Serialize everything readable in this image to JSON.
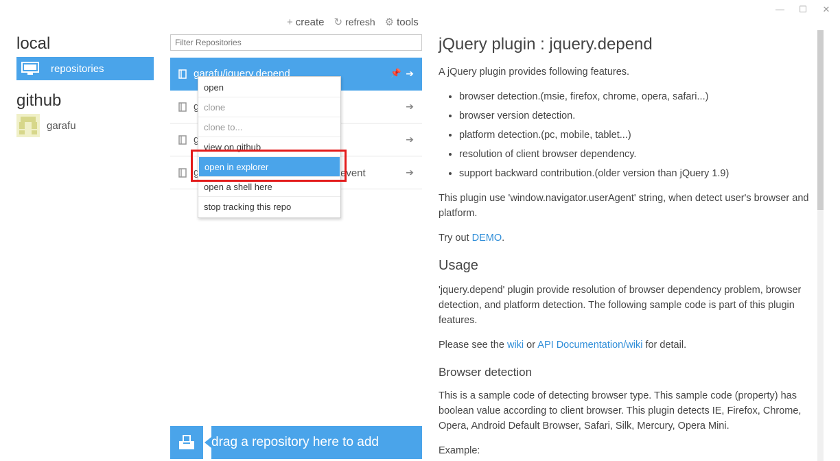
{
  "window": {
    "minimize": "—",
    "maximize": "☐",
    "close": "✕"
  },
  "nav": {
    "local_heading": "local",
    "local_items": [
      {
        "label": "repositories",
        "icon": "monitor-icon"
      }
    ],
    "github_heading": "github",
    "github_items": [
      {
        "label": "garafu",
        "icon": "avatar"
      }
    ]
  },
  "toolbar": {
    "create": "create",
    "refresh": "refresh",
    "tools": "tools"
  },
  "filter": {
    "placeholder": "Filter Repositories"
  },
  "repos": [
    {
      "name": "garafu/jquery.depend",
      "selected": true
    },
    {
      "name": "g"
    },
    {
      "name": "g"
    },
    {
      "name": "g",
      "suffix": "event"
    }
  ],
  "context_menu": {
    "items": [
      {
        "label": "open",
        "enabled": true
      },
      {
        "label": "clone",
        "enabled": false
      },
      {
        "label": "clone to...",
        "enabled": false
      },
      {
        "label": "view on github",
        "enabled": true
      },
      {
        "label": "open in explorer",
        "enabled": true,
        "highlighted": true
      },
      {
        "label": "open a shell here",
        "enabled": true
      },
      {
        "label": "stop tracking this repo",
        "enabled": true
      }
    ]
  },
  "dropzone": {
    "label": "drag a repository here to add"
  },
  "readme": {
    "title": "jQuery plugin : jquery.depend",
    "intro": "A jQuery plugin provides following features.",
    "features": [
      "browser detection.(msie, firefox, chrome, opera, safari...)",
      "browser version detection.",
      "platform detection.(pc, mobile, tablet...)",
      "resolution of client browser dependency.",
      "support backward contribution.(older version than jQuery 1.9)"
    ],
    "useragent_text": "This plugin use 'window.navigator.userAgent' string, when detect user's browser and platform.",
    "tryout_prefix": "Try out ",
    "demo_link": "DEMO",
    "tryout_suffix": ".",
    "usage_heading": "Usage",
    "usage_text": "'jquery.depend' plugin provide resolution of browser dependency problem, browser detection, and platform detection. The following sample code is part of this plugin features.",
    "see_prefix": "Please see the ",
    "wiki_link": "wiki",
    "see_or": " or ",
    "api_link": "API Documentation/wiki",
    "see_suffix": " for detail.",
    "browser_heading": "Browser detection",
    "browser_text": "This is a sample code of detecting browser type. This sample code (property) has boolean value according to client browser. This plugin detects IE, Firefox, Chrome, Opera, Android Default Browser, Safari, Silk, Mercury, Opera Mini.",
    "example_label": "Example:"
  }
}
